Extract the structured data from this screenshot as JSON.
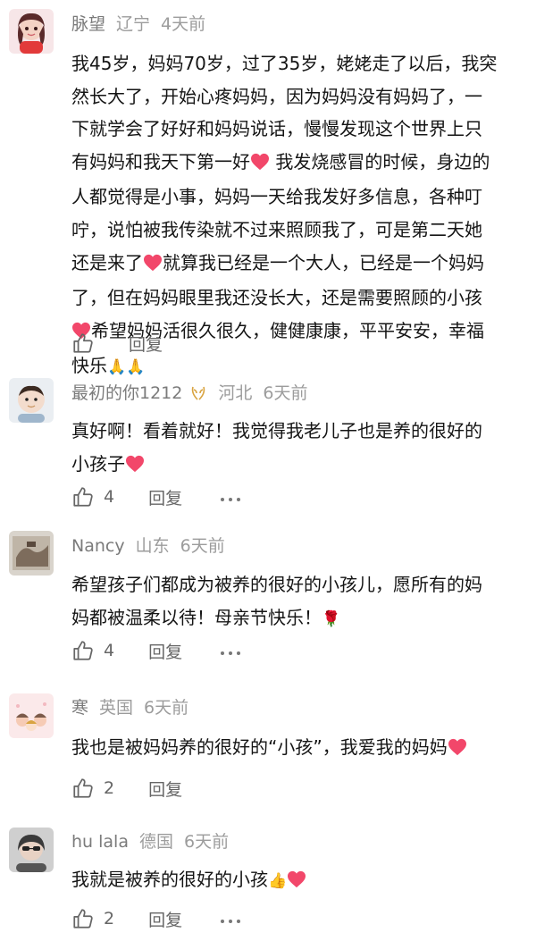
{
  "comments": [
    {
      "username": "脉望",
      "location": "辽宁",
      "time": "4天前",
      "lines": [
        "我45岁，妈妈70岁，过了35岁，姥姥走了以后，我突",
        "然长大了，开始心疼妈妈，因为妈妈没有妈妈了，一",
        "下就学会了好好和妈妈说话，慢慢发现这个世界上只",
        "有妈妈和我天下第一好",
        "我发烧感冒的时候，身边的",
        "人都觉得是小事，妈妈一天给我发好多信息，各种叮",
        "咛，说怕被我传染就不过来照顾我了，可是第二天她",
        "还是来了",
        "就算我已经是一个大人，已经是一个妈妈",
        "了，但在妈妈眼里我还没长大，还是需要照顾的小孩",
        "希望妈妈活很久很久，健健康康，平平安安，幸福",
        "快乐",
        "🙏🙏"
      ],
      "reply_label": "回复"
    },
    {
      "username": "最初的你1212",
      "location": "河北",
      "time": "6天前",
      "lines": [
        "真好啊！看着就好！我觉得我老儿子也是养的很好的",
        "小孩子"
      ],
      "like_count": "4",
      "reply_label": "回复"
    },
    {
      "username": "Nancy",
      "location": "山东",
      "time": "6天前",
      "lines": [
        "希望孩子们都成为被养的很好的小孩儿，愿所有的妈",
        "妈都被温柔以待！母亲节快乐！",
        "🌹"
      ],
      "like_count": "4",
      "reply_label": "回复"
    },
    {
      "username": "寒",
      "location": "英国",
      "time": "6天前",
      "lines": [
        "我也是被妈妈养的很好的“小孩”，我爱我的妈妈"
      ],
      "like_count": "2",
      "reply_label": "回复"
    },
    {
      "username": "hu lala",
      "location": "德国",
      "time": "6天前",
      "lines": [
        "我就是被养的很好的小孩",
        "👍"
      ],
      "like_count": "2",
      "reply_label": "回复"
    }
  ],
  "icons": {
    "heart": "heart-icon",
    "like": "thumbs-up-icon",
    "more": "more-dots-icon",
    "badge": "wheat-badge-icon"
  },
  "colors": {
    "heart": "#f2476a",
    "meta_gray": "#9c9c9c",
    "username_gray": "#7b7b7b",
    "action_gray": "#666666"
  }
}
